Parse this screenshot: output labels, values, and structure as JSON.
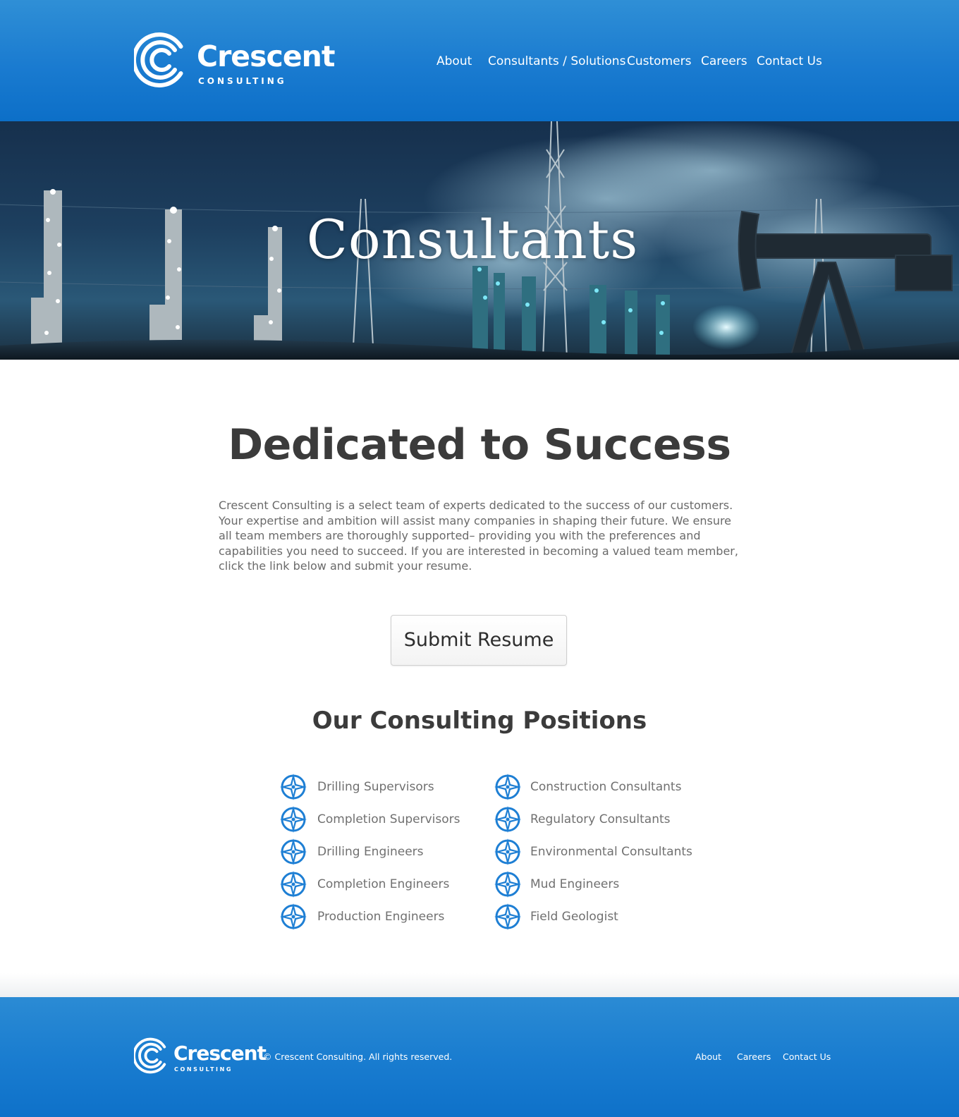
{
  "colors": {
    "brand_blue": "#1a7bd0",
    "heading_text": "#3b3b3b",
    "body_text": "#6a6a6a",
    "icon_blue": "#1e7fd4",
    "white": "#ffffff"
  },
  "header": {
    "logo": {
      "name": "Crescent",
      "tagline": "CONSULTING",
      "icon": "crescent-logo-icon"
    },
    "nav": [
      {
        "label": "About"
      },
      {
        "label": "Consultants / Solutions"
      },
      {
        "label": "Customers"
      },
      {
        "label": "Careers"
      },
      {
        "label": "Contact Us"
      }
    ]
  },
  "hero": {
    "title": "Consultants"
  },
  "main": {
    "title": "Dedicated to Success",
    "intro": "Crescent Consulting is a select team of experts dedicated to the success of our customers. Your expertise and ambition will assist many companies in shaping their future. We ensure all team members are thoroughly supported– providing you with the preferences and capabilities you need to succeed. If you are interested in becoming a valued team member, click the link below and submit your resume.",
    "submit_button": "Submit Resume"
  },
  "positions": {
    "title": "Our Consulting Positions",
    "icon": "compass-star-icon",
    "left": [
      "Drilling Supervisors",
      "Completion Supervisors",
      "Drilling Engineers",
      "Completion Engineers",
      "Production Engineers"
    ],
    "right": [
      "Construction Consultants",
      "Regulatory Consultants",
      "Environmental Consultants",
      "Mud Engineers",
      "Field Geologist"
    ]
  },
  "footer": {
    "logo": {
      "name": "Crescent",
      "tagline": "CONSULTING"
    },
    "copyright": "© Crescent Consulting. All rights reserved.",
    "nav": [
      {
        "label": "About"
      },
      {
        "label": "Careers"
      },
      {
        "label": "Contact Us"
      }
    ]
  }
}
